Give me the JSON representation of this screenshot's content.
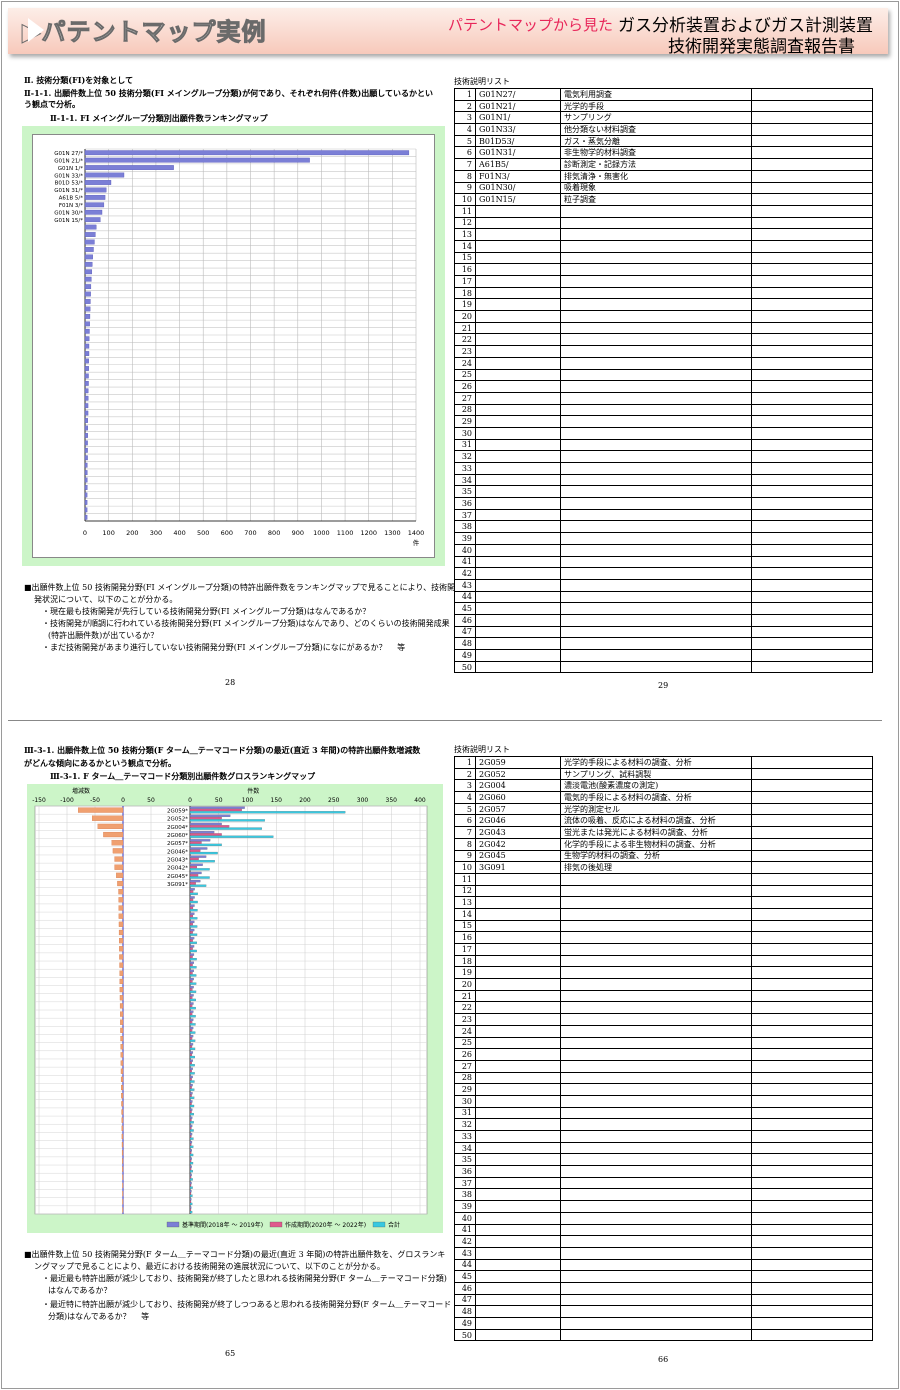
{
  "header": {
    "title": "パテントマップ実例",
    "subtitle": "パテントマップから見た",
    "report_line1": "ガス分析装置およびガス計測装置",
    "report_line2": "技術開発実態調査報告書"
  },
  "top_left": {
    "section": "Ⅱ. 技術分類(FI)を対象として",
    "q_line1": "Ⅱ-1-1. 出願件数上位 50 技術分類(FI メイングループ分類)が何であり、それぞれ何件(件数)出願しているかとい",
    "q_line2": "う観点で分析。",
    "chart_title": "Ⅱ-1-1. FI メイングループ分類別出願件数ランキングマップ",
    "notes": [
      "■出願件数上位 50 技術開発分野(FI メイングループ分類)の特許出願件数をランキングマップで見ることにより、技術開",
      "発状況について、以下のことが分かる。",
      "・現在最も技術開発が先行している技術開発分野(FI メイングループ分類)はなんであるか？",
      "・技術開発が順調に行われている技術開発分野(FI メイングループ分類)はなんであり、どのくらいの技術開発成果",
      "(特許出願件数)が出ているか？",
      "・まだ技術開発があまり進行していない技術開発分野(FI メイングループ分類)になにがあるか？　 等"
    ],
    "page": "28"
  },
  "top_right": {
    "list_title": "技術説明リスト",
    "rows": [
      {
        "no": "1",
        "code": "G01N27/",
        "desc": "電気利用調査"
      },
      {
        "no": "2",
        "code": "G01N21/",
        "desc": "光学的手段"
      },
      {
        "no": "3",
        "code": "G01N1/",
        "desc": "サンプリング"
      },
      {
        "no": "4",
        "code": "G01N33/",
        "desc": "他分類ない材料調査"
      },
      {
        "no": "5",
        "code": "B01D53/",
        "desc": "ガス・蒸気分離"
      },
      {
        "no": "6",
        "code": "G01N31/",
        "desc": "非生物学的材料調査"
      },
      {
        "no": "7",
        "code": "A61B5/",
        "desc": "診断測定・記録方法"
      },
      {
        "no": "8",
        "code": "F01N3/",
        "desc": "排気清浄・無害化"
      },
      {
        "no": "9",
        "code": "G01N30/",
        "desc": "吸着現象"
      },
      {
        "no": "10",
        "code": "G01N15/",
        "desc": "粒子調査"
      },
      {
        "no": "11",
        "code": "",
        "desc": ""
      },
      {
        "no": "12",
        "code": "",
        "desc": ""
      },
      {
        "no": "13",
        "code": "",
        "desc": ""
      },
      {
        "no": "14",
        "code": "",
        "desc": ""
      },
      {
        "no": "15",
        "code": "",
        "desc": ""
      },
      {
        "no": "16",
        "code": "",
        "desc": ""
      },
      {
        "no": "17",
        "code": "",
        "desc": ""
      },
      {
        "no": "18",
        "code": "",
        "desc": ""
      },
      {
        "no": "19",
        "code": "",
        "desc": ""
      },
      {
        "no": "20",
        "code": "",
        "desc": ""
      },
      {
        "no": "21",
        "code": "",
        "desc": ""
      },
      {
        "no": "22",
        "code": "",
        "desc": ""
      },
      {
        "no": "23",
        "code": "",
        "desc": ""
      },
      {
        "no": "24",
        "code": "",
        "desc": ""
      },
      {
        "no": "25",
        "code": "",
        "desc": ""
      },
      {
        "no": "26",
        "code": "",
        "desc": ""
      },
      {
        "no": "27",
        "code": "",
        "desc": ""
      },
      {
        "no": "28",
        "code": "",
        "desc": ""
      },
      {
        "no": "29",
        "code": "",
        "desc": ""
      },
      {
        "no": "30",
        "code": "",
        "desc": ""
      },
      {
        "no": "31",
        "code": "",
        "desc": ""
      },
      {
        "no": "32",
        "code": "",
        "desc": ""
      },
      {
        "no": "33",
        "code": "",
        "desc": ""
      },
      {
        "no": "34",
        "code": "",
        "desc": ""
      },
      {
        "no": "35",
        "code": "",
        "desc": ""
      },
      {
        "no": "36",
        "code": "",
        "desc": ""
      },
      {
        "no": "37",
        "code": "",
        "desc": ""
      },
      {
        "no": "38",
        "code": "",
        "desc": ""
      },
      {
        "no": "39",
        "code": "",
        "desc": ""
      },
      {
        "no": "40",
        "code": "",
        "desc": ""
      },
      {
        "no": "41",
        "code": "",
        "desc": ""
      },
      {
        "no": "42",
        "code": "",
        "desc": ""
      },
      {
        "no": "43",
        "code": "",
        "desc": ""
      },
      {
        "no": "44",
        "code": "",
        "desc": ""
      },
      {
        "no": "45",
        "code": "",
        "desc": ""
      },
      {
        "no": "46",
        "code": "",
        "desc": ""
      },
      {
        "no": "47",
        "code": "",
        "desc": ""
      },
      {
        "no": "48",
        "code": "",
        "desc": ""
      },
      {
        "no": "49",
        "code": "",
        "desc": ""
      },
      {
        "no": "50",
        "code": "",
        "desc": ""
      }
    ],
    "page": "29"
  },
  "bottom_left": {
    "q_line1": "Ⅲ-3-1. 出願件数上位 50 技術分類(F ターム＿テーマコード分類)の最近(直近 3 年間)の特許出願件数増減数",
    "q_line2": "がどんな傾向にあるかという観点で分析。",
    "chart_title": "Ⅲ-3-1. F ターム＿テーマコード分類別出願件数グロスランキングマップ",
    "notes": [
      "■出願件数上位 50 技術開発分野(F ターム＿テーマコード分類)の最近(直近 3 年間)の特許出願件数を、グロスランキ",
      "ングマップで見ることにより、最近における技術開発の進展状況について、以下のことが分かる。",
      "・最近最も特許出願が減少しており、技術開発が終了したと思われる技術開発分野(F ターム＿テーマコード分類)",
      "はなんであるか？",
      "・最近特に特許出願が減少しており、技術開発が終了しつつあると思われる技術開発分野(F ターム＿テーマコード",
      "分類)はなんであるか？　 等"
    ],
    "page": "65"
  },
  "bottom_right": {
    "list_title": "技術説明リスト",
    "rows": [
      {
        "no": "1",
        "code": "2G059",
        "desc": "光学的手段による材料の調査、分析"
      },
      {
        "no": "2",
        "code": "2G052",
        "desc": "サンプリング、試料調製"
      },
      {
        "no": "3",
        "code": "2G004",
        "desc": "濃淡電池(酸素濃度の測定)"
      },
      {
        "no": "4",
        "code": "2G060",
        "desc": "電気的手段による材料の調査、分析"
      },
      {
        "no": "5",
        "code": "2G057",
        "desc": "光学的測定セル"
      },
      {
        "no": "6",
        "code": "2G046",
        "desc": "流体の吸着、反応による材料の調査、分析"
      },
      {
        "no": "7",
        "code": "2G043",
        "desc": "蛍光または発光による材料の調査、分析"
      },
      {
        "no": "8",
        "code": "2G042",
        "desc": "化学的手段による非生物材料の調査、分析"
      },
      {
        "no": "9",
        "code": "2G045",
        "desc": "生物学的材料の調査、分析"
      },
      {
        "no": "10",
        "code": "3G091",
        "desc": "排気の後処理"
      },
      {
        "no": "11",
        "code": "",
        "desc": ""
      },
      {
        "no": "12",
        "code": "",
        "desc": ""
      },
      {
        "no": "13",
        "code": "",
        "desc": ""
      },
      {
        "no": "14",
        "code": "",
        "desc": ""
      },
      {
        "no": "15",
        "code": "",
        "desc": ""
      },
      {
        "no": "16",
        "code": "",
        "desc": ""
      },
      {
        "no": "17",
        "code": "",
        "desc": ""
      },
      {
        "no": "18",
        "code": "",
        "desc": ""
      },
      {
        "no": "19",
        "code": "",
        "desc": ""
      },
      {
        "no": "20",
        "code": "",
        "desc": ""
      },
      {
        "no": "21",
        "code": "",
        "desc": ""
      },
      {
        "no": "22",
        "code": "",
        "desc": ""
      },
      {
        "no": "23",
        "code": "",
        "desc": ""
      },
      {
        "no": "24",
        "code": "",
        "desc": ""
      },
      {
        "no": "25",
        "code": "",
        "desc": ""
      },
      {
        "no": "26",
        "code": "",
        "desc": ""
      },
      {
        "no": "27",
        "code": "",
        "desc": ""
      },
      {
        "no": "28",
        "code": "",
        "desc": ""
      },
      {
        "no": "29",
        "code": "",
        "desc": ""
      },
      {
        "no": "30",
        "code": "",
        "desc": ""
      },
      {
        "no": "31",
        "code": "",
        "desc": ""
      },
      {
        "no": "32",
        "code": "",
        "desc": ""
      },
      {
        "no": "33",
        "code": "",
        "desc": ""
      },
      {
        "no": "34",
        "code": "",
        "desc": ""
      },
      {
        "no": "35",
        "code": "",
        "desc": ""
      },
      {
        "no": "36",
        "code": "",
        "desc": ""
      },
      {
        "no": "37",
        "code": "",
        "desc": ""
      },
      {
        "no": "38",
        "code": "",
        "desc": ""
      },
      {
        "no": "39",
        "code": "",
        "desc": ""
      },
      {
        "no": "40",
        "code": "",
        "desc": ""
      },
      {
        "no": "41",
        "code": "",
        "desc": ""
      },
      {
        "no": "42",
        "code": "",
        "desc": ""
      },
      {
        "no": "43",
        "code": "",
        "desc": ""
      },
      {
        "no": "44",
        "code": "",
        "desc": ""
      },
      {
        "no": "45",
        "code": "",
        "desc": ""
      },
      {
        "no": "46",
        "code": "",
        "desc": ""
      },
      {
        "no": "47",
        "code": "",
        "desc": ""
      },
      {
        "no": "48",
        "code": "",
        "desc": ""
      },
      {
        "no": "49",
        "code": "",
        "desc": ""
      },
      {
        "no": "50",
        "code": "",
        "desc": ""
      }
    ],
    "page": "66"
  },
  "chart_data": [
    {
      "type": "bar",
      "orientation": "horizontal",
      "categories": [
        "G01N 27/*",
        "G01N 21/*",
        "G01N 1/*",
        "G01N 33/*",
        "B01D 53/*",
        "G01N 31/*",
        "A61B 5/*",
        "F01N 3/*",
        "G01N 30/*",
        "G01N 15/*"
      ],
      "values": [
        1370,
        950,
        375,
        165,
        110,
        90,
        85,
        80,
        72,
        65
      ],
      "remaining_values": [
        48,
        44,
        40,
        36,
        33,
        31,
        29,
        27,
        25,
        24,
        23,
        22,
        21,
        20,
        19,
        18,
        17,
        17,
        16,
        16,
        15,
        15,
        14,
        14,
        13,
        13,
        12,
        12,
        12,
        11,
        11,
        11,
        10,
        10,
        10,
        10,
        9,
        9,
        9,
        9
      ],
      "xticks": [
        "0",
        "100",
        "200",
        "300",
        "400",
        "500",
        "600",
        "700",
        "800",
        "900",
        "1000",
        "1100",
        "1200",
        "1300",
        "1400"
      ],
      "xlim": [
        0,
        1400
      ],
      "unit": "件",
      "bar_color": "#7b7fd6",
      "grid": true
    },
    {
      "type": "bar",
      "orientation": "horizontal",
      "categories": [
        "2G059*",
        "2G052*",
        "2G004*",
        "2G060*",
        "2G057*",
        "2G046*",
        "2G043*",
        "2G042*",
        "2G045*",
        "3G091*"
      ],
      "left_axis_label": "増減数",
      "left_xticks": [
        "-150",
        "-100",
        "-50",
        "0",
        "50"
      ],
      "left_xlim": [
        -150,
        50
      ],
      "right_axis_label": "件数",
      "right_xticks": [
        "0",
        "50",
        "100",
        "150",
        "200",
        "250",
        "300",
        "350",
        "400"
      ],
      "right_xlim": [
        0,
        400
      ],
      "series": [
        {
          "name": "基準期間(2018年 ～ 2019年)",
          "color": "#7b7fd6",
          "values": [
            95,
            70,
            55,
            42,
            35,
            30,
            28,
            22,
            20,
            18
          ]
        },
        {
          "name": "作成期間(2020年 ～ 2022年)",
          "color": "#e0588c",
          "values": [
            90,
            55,
            68,
            55,
            20,
            18,
            15,
            12,
            14,
            10
          ]
        },
        {
          "name": "合計",
          "color": "#38c8e0",
          "values": [
            270,
            130,
            125,
            145,
            55,
            48,
            43,
            34,
            34,
            28
          ]
        }
      ],
      "change_values": [
        -80,
        -55,
        -45,
        -35,
        -20,
        -18,
        -15,
        -15,
        -12,
        -10
      ],
      "change_color": "#f0a070",
      "grid": true
    }
  ]
}
